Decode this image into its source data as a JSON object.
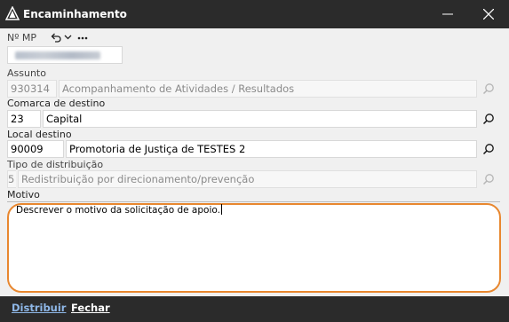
{
  "window": {
    "title": "Encaminhamento"
  },
  "mp": {
    "label": "Nº MP"
  },
  "assunto": {
    "label": "Assunto",
    "code": "930314",
    "description": "Acompanhamento de Atividades / Resultados"
  },
  "comarca": {
    "label": "Comarca de destino",
    "code": "23",
    "description": "Capital"
  },
  "local": {
    "label": "Local destino",
    "code": "90009",
    "description": "Promotoria de Justiça de TESTES 2"
  },
  "tipo": {
    "label": "Tipo de distribuição",
    "code": "5",
    "description": "Redistribuição por direcionamento/prevenção"
  },
  "motivo": {
    "label": "Motivo",
    "text": "Descrever o motivo da solicitação de apoio."
  },
  "actions": {
    "primary_label": "Distribuir",
    "secondary_label": "Fechar"
  },
  "colors": {
    "titlebar": "#2b2b2b",
    "highlight_border": "#e8872f",
    "primary_action": "#8fb8e8"
  }
}
